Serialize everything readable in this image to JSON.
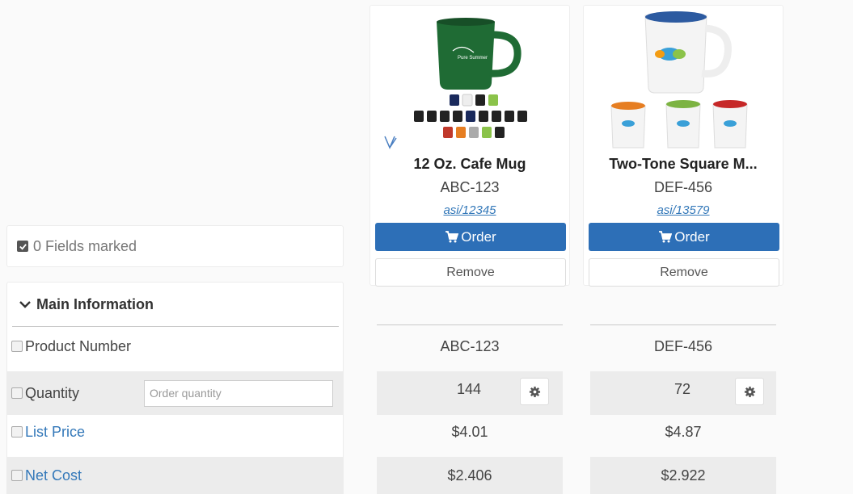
{
  "fields_marked": {
    "label": "0 Fields marked"
  },
  "section": {
    "title": "Main Information"
  },
  "products": [
    {
      "name": "12 Oz. Cafe Mug",
      "sku": "ABC-123",
      "link": "asi/12345",
      "order_label": "Order",
      "remove_label": "Remove"
    },
    {
      "name": "Two-Tone Square M...",
      "sku": "DEF-456",
      "link": "asi/13579",
      "order_label": "Order",
      "remove_label": "Remove"
    }
  ],
  "rows": {
    "product_number": {
      "label": "Product Number",
      "values": [
        "ABC-123",
        "DEF-456"
      ]
    },
    "quantity": {
      "label": "Quantity",
      "placeholder": "Order quantity",
      "values": [
        "144",
        "72"
      ]
    },
    "list_price": {
      "label": "List Price",
      "values": [
        "$4.01",
        "$4.87"
      ]
    },
    "net_cost": {
      "label": "Net Cost",
      "values": [
        "$2.406",
        "$2.922"
      ]
    }
  },
  "colors": {
    "accent": "#2d6fb7",
    "link": "#3378b9",
    "mug_green": "#1f6b34"
  },
  "icons": {
    "checkbox": "check-square-icon",
    "chevron": "chevron-down-icon",
    "cart": "cart-icon",
    "gear": "gear-icon"
  }
}
